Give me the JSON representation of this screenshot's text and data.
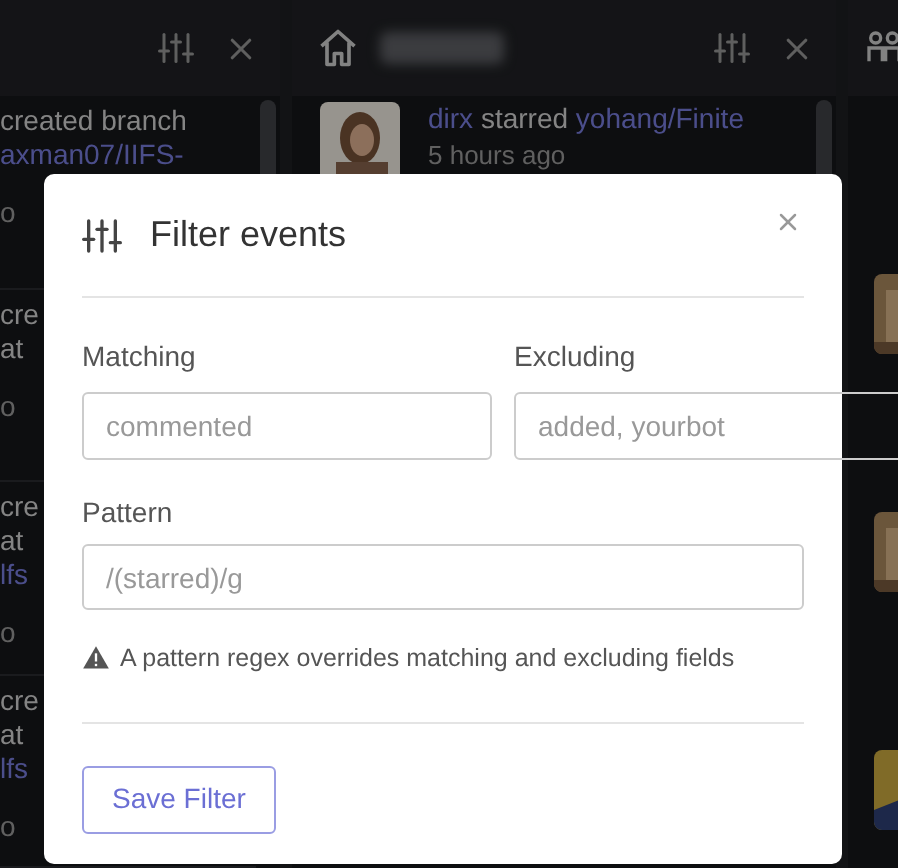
{
  "left_column": {
    "items": [
      {
        "lines": [
          {
            "kind": "text",
            "text": "created branch"
          },
          {
            "kind": "link",
            "text": "axman07/IIFS-"
          }
        ],
        "time": "o"
      },
      {
        "lines": [
          {
            "kind": "text",
            "text": "cre"
          },
          {
            "kind": "text",
            "text": "at"
          }
        ],
        "time": "o"
      },
      {
        "lines": [
          {
            "kind": "text",
            "text": "cre"
          },
          {
            "kind": "text",
            "text": "at"
          },
          {
            "kind": "link",
            "text": "lfs"
          }
        ],
        "time": "o"
      },
      {
        "lines": [
          {
            "kind": "text",
            "text": "cre"
          },
          {
            "kind": "text",
            "text": "at"
          },
          {
            "kind": "link",
            "text": "lfs"
          }
        ],
        "time": "o"
      }
    ]
  },
  "middle_column": {
    "events": [
      {
        "actor": "dirx",
        "action": "starred",
        "repo": "yohang/Finite",
        "time": "5 hours ago"
      }
    ]
  },
  "dialog": {
    "title": "Filter events",
    "matching": {
      "label": "Matching",
      "placeholder": "commented"
    },
    "excluding": {
      "label": "Excluding",
      "placeholder": "added, yourbot"
    },
    "pattern": {
      "label": "Pattern",
      "placeholder": "/(starred)/g"
    },
    "warning": "A pattern regex overrides matching and excluding fields",
    "save_button": "Save Filter"
  }
}
